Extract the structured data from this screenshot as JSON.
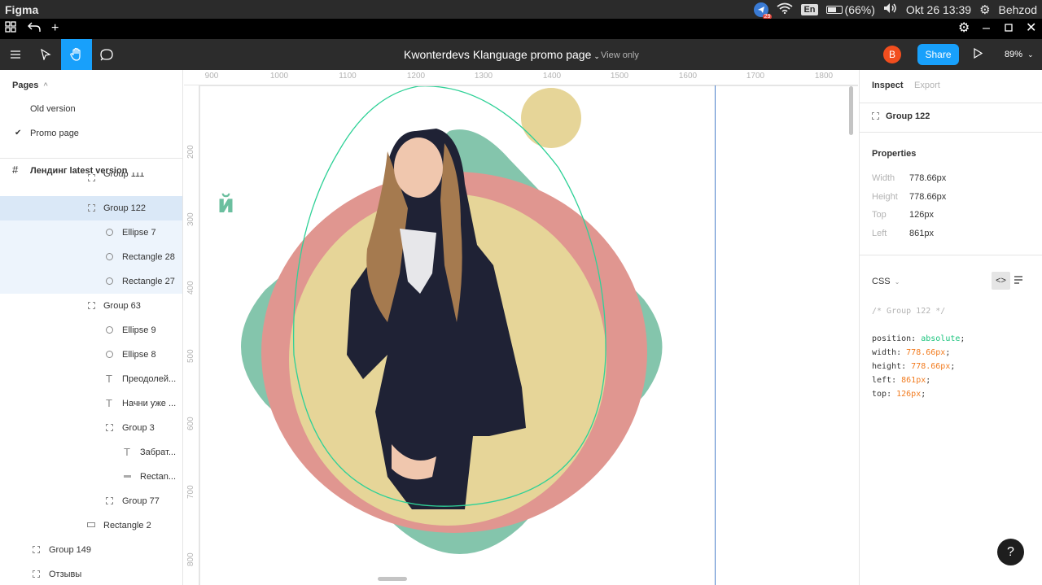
{
  "os": {
    "app_name": "Figma",
    "notify_count": "29",
    "lang": "En",
    "battery": "(66%)",
    "datetime": "Okt 26 13:39",
    "user": "Behzod",
    "icons": [
      "telegram-icon",
      "wifi-icon",
      "battery-icon",
      "volume-icon",
      "settings-icon"
    ]
  },
  "tabbar": {
    "icons": [
      "grid-icon",
      "undo-icon",
      "plus-icon",
      "gear-icon",
      "minimize-icon",
      "maximize-icon",
      "close-icon"
    ]
  },
  "toolbar": {
    "doc_title": "Kwonterdevs Klanguage promo page",
    "view_mode": "View only",
    "avatar_initial": "B",
    "share_label": "Share",
    "zoom": "89%"
  },
  "pages": {
    "header": "Pages",
    "items": [
      {
        "label": "Old version",
        "checked": false
      },
      {
        "label": "Promo page",
        "checked": true
      }
    ]
  },
  "layers": {
    "frame": "Лендинг latest version",
    "items": [
      {
        "label": "Group 111",
        "type": "group"
      },
      {
        "label": "Group 122",
        "type": "group"
      },
      {
        "label": "Ellipse 7",
        "type": "ellipse"
      },
      {
        "label": "Rectangle 28",
        "type": "ellipse"
      },
      {
        "label": "Rectangle 27",
        "type": "ellipse"
      },
      {
        "label": "Group 63",
        "type": "group"
      },
      {
        "label": "Ellipse 9",
        "type": "ellipse"
      },
      {
        "label": "Ellipse 8",
        "type": "ellipse"
      },
      {
        "label": "Преодолей...",
        "type": "text"
      },
      {
        "label": "Начни уже ...",
        "type": "text"
      },
      {
        "label": "Group 3",
        "type": "group"
      },
      {
        "label": "Забрат...",
        "type": "text"
      },
      {
        "label": "Rectan...",
        "type": "line"
      },
      {
        "label": "Group 77",
        "type": "group"
      },
      {
        "label": "Rectangle 2",
        "type": "rect"
      },
      {
        "label": "Group 149",
        "type": "group"
      },
      {
        "label": "Отзывы",
        "type": "group"
      }
    ]
  },
  "ruler": {
    "top": [
      "900",
      "1000",
      "1100",
      "1200",
      "1300",
      "1400",
      "1500",
      "1600",
      "1700",
      "1800"
    ],
    "left": [
      "200",
      "300",
      "400",
      "500",
      "600",
      "700",
      "800"
    ]
  },
  "canvas": {
    "letter": "й",
    "colors": {
      "green": "#84c5ac",
      "pink": "#e09690",
      "yellow": "#e6d598",
      "outline": "#2fd197"
    }
  },
  "inspect": {
    "tab_inspect": "Inspect",
    "tab_export": "Export",
    "selection": "Group 122",
    "properties_header": "Properties",
    "props": [
      {
        "k": "Width",
        "v": "778.66px"
      },
      {
        "k": "Height",
        "v": "778.66px"
      },
      {
        "k": "Top",
        "v": "126px"
      },
      {
        "k": "Left",
        "v": "861px"
      }
    ],
    "css_header": "CSS",
    "css_comment": "/* Group 122 */",
    "css_lines": [
      {
        "prop": "position",
        "val": "absolute",
        "kind": "kw"
      },
      {
        "prop": "width",
        "val": "778.66px",
        "kind": "num"
      },
      {
        "prop": "height",
        "val": "778.66px",
        "kind": "num"
      },
      {
        "prop": "left",
        "val": "861px",
        "kind": "num"
      },
      {
        "prop": "top",
        "val": "126px",
        "kind": "num"
      }
    ],
    "help": "?"
  }
}
